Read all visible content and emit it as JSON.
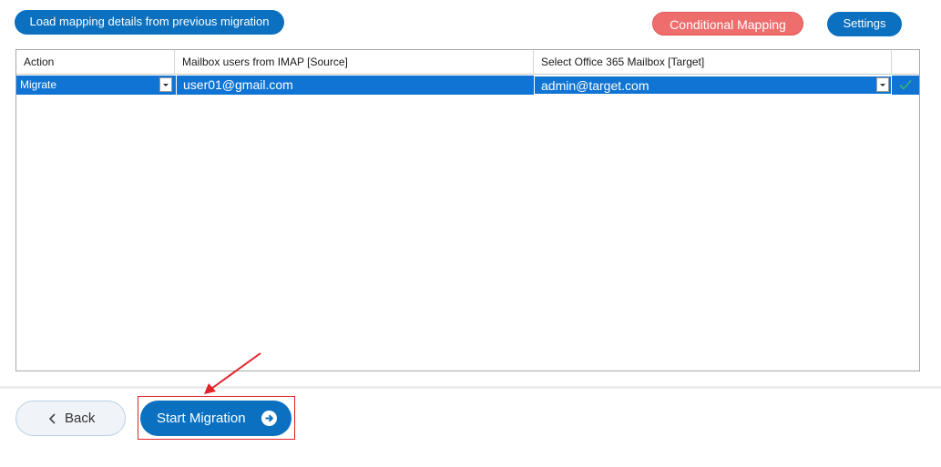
{
  "toolbar": {
    "load_mapping_label": "Load mapping details from previous migration",
    "conditional_mapping_label": "Conditional Mapping",
    "settings_label": "Settings"
  },
  "grid": {
    "columns": [
      "Action",
      "Mailbox users from IMAP [Source]",
      "Select Office 365 Mailbox [Target]",
      ""
    ],
    "rows": [
      {
        "action": "Migrate",
        "source": "user01@gmail.com",
        "target": "admin@target.com",
        "status_icon": "check-icon"
      }
    ]
  },
  "footer": {
    "back_label": "Back",
    "start_label": "Start Migration"
  },
  "colors": {
    "primary": "#0a70bf",
    "conditional": "#ee6d6d",
    "row_selected": "#0f74d3",
    "annotation": "#e0242a",
    "check": "#3cb371"
  }
}
